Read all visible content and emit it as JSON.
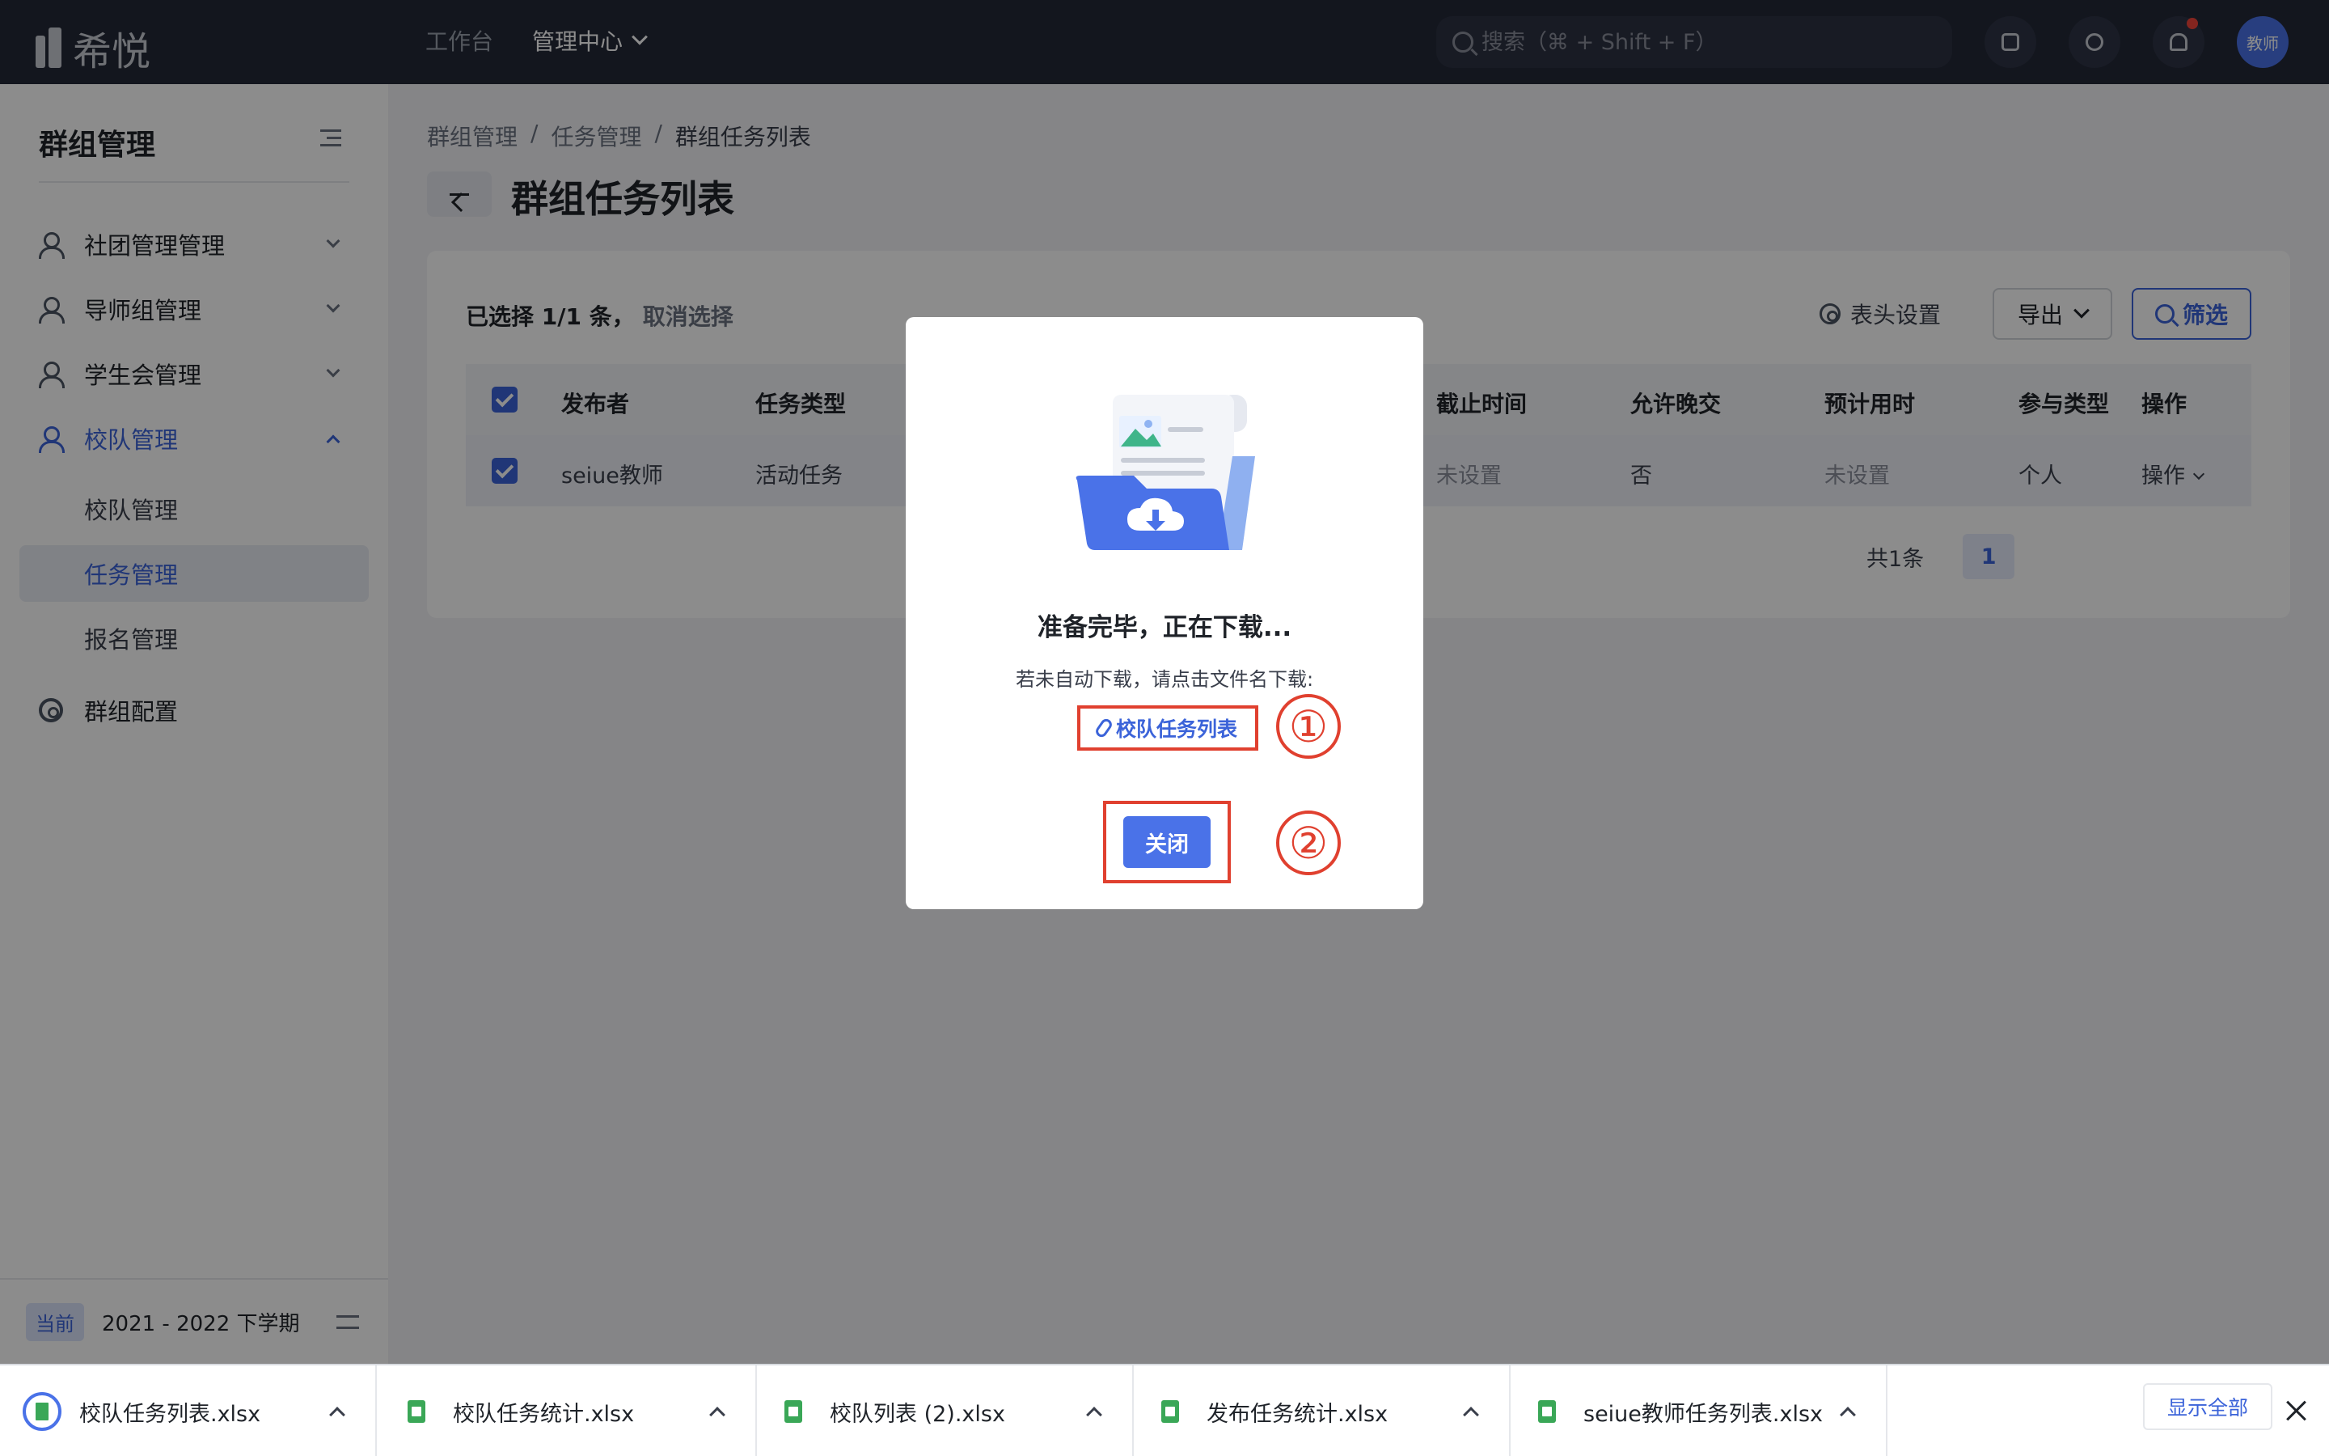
{
  "app": {
    "logo_text": "希悦"
  },
  "topnav": {
    "workbench": "工作台",
    "admin_center": "管理中心"
  },
  "search": {
    "placeholder": "搜索（⌘ + Shift + F）"
  },
  "avatar": {
    "label": "教师"
  },
  "sidebar": {
    "title": "群组管理",
    "items": [
      {
        "label": "社团管理管理"
      },
      {
        "label": "导师组管理"
      },
      {
        "label": "学生会管理"
      },
      {
        "label": "校队管理"
      }
    ],
    "sub_items": [
      {
        "label": "校队管理"
      },
      {
        "label": "任务管理"
      },
      {
        "label": "报名管理"
      }
    ],
    "config_label": "群组配置",
    "semester_badge": "当前",
    "semester_text": "2021 - 2022 下学期"
  },
  "breadcrumb": {
    "level1": "群组管理",
    "sep": "/",
    "level2": "任务管理",
    "level3": "群组任务列表"
  },
  "page": {
    "title": "群组任务列表"
  },
  "toolbar": {
    "selection": "已选择 1/1 条，",
    "cancel_selection": "取消选择",
    "column_settings": "表头设置",
    "export": "导出",
    "filter": "筛选"
  },
  "table": {
    "headers": {
      "publisher": "发布者",
      "task_type": "任务类型",
      "deadline": "截止时间",
      "allow_late": "允许晚交",
      "estimated": "预计用时",
      "participation": "参与类型",
      "action": "操作"
    },
    "rows": [
      {
        "publisher": "seiue教师",
        "task_type": "活动任务",
        "deadline": "未设置",
        "allow_late": "否",
        "estimated": "未设置",
        "participation": "个人",
        "action": "操作"
      }
    ]
  },
  "pager": {
    "total": "共1条",
    "current_page": "1"
  },
  "modal": {
    "title": "准备完毕，正在下载...",
    "hint": "若未自动下载，请点击文件名下载:",
    "file_link": "校队任务列表",
    "close": "关闭",
    "marker1": "①",
    "marker2": "②"
  },
  "downloads": {
    "items": [
      {
        "name": "校队任务列表.xlsx"
      },
      {
        "name": "校队任务统计.xlsx"
      },
      {
        "name": "校队列表 (2).xlsx"
      },
      {
        "name": "发布任务统计.xlsx"
      },
      {
        "name": "seiue教师任务列表.xlsx"
      }
    ],
    "show_all": "显示全部"
  },
  "colors": {
    "accent": "#3b63d9",
    "topbar": "#232838",
    "annotation": "#e0402f",
    "button": "#4a72e8"
  }
}
